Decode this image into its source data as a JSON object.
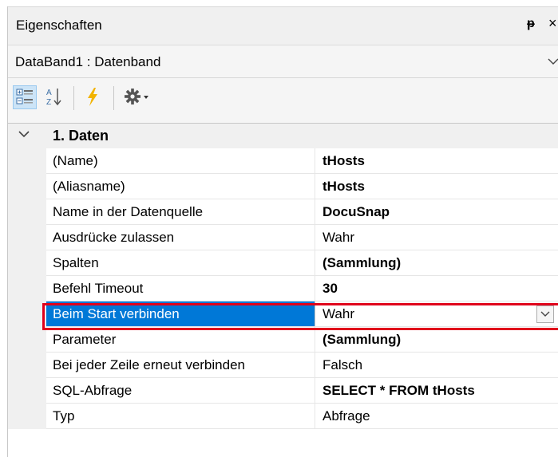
{
  "panel": {
    "title": "Eigenschaften",
    "pin_glyph": "ᵽ",
    "close_glyph": "×"
  },
  "object_selector": {
    "selected": "DataBand1 : Datenband"
  },
  "toolbar": {
    "buttons": [
      "categorized-view",
      "alphabetical-sort",
      "events",
      "settings"
    ]
  },
  "category": {
    "title": "1. Daten",
    "expanded": true
  },
  "properties": [
    {
      "name": "(Name)",
      "value": "tHosts",
      "bold": true
    },
    {
      "name": "(Aliasname)",
      "value": "tHosts",
      "bold": true
    },
    {
      "name": "Name in der Datenquelle",
      "value": "DocuSnap",
      "bold": true
    },
    {
      "name": "Ausdrücke zulassen",
      "value": "Wahr",
      "bold": false
    },
    {
      "name": "Spalten",
      "value": "(Sammlung)",
      "bold": true
    },
    {
      "name": "Befehl Timeout",
      "value": "30",
      "bold": true
    },
    {
      "name": "Beim Start verbinden",
      "value": "Wahr",
      "bold": false,
      "selected": true
    },
    {
      "name": "Parameter",
      "value": "(Sammlung)",
      "bold": true
    },
    {
      "name": "Bei jeder Zeile erneut verbinden",
      "value": "Falsch",
      "bold": false
    },
    {
      "name": "SQL-Abfrage",
      "value": "SELECT * FROM tHosts",
      "bold": true
    },
    {
      "name": "Typ",
      "value": "Abfrage",
      "bold": false
    }
  ],
  "colors": {
    "selection": "#0078d7",
    "highlight_frame": "#e0001b",
    "header_bg": "#f0f0f0"
  }
}
